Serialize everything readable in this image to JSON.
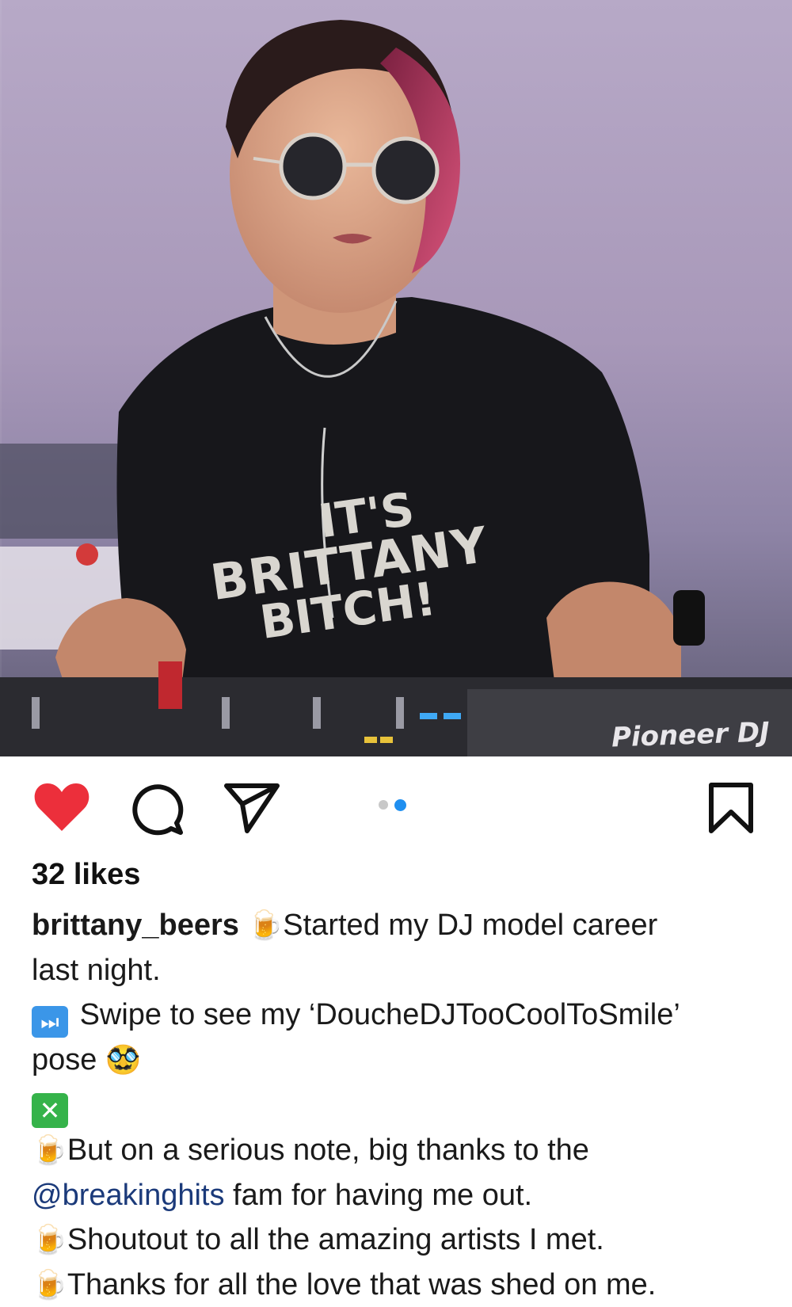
{
  "photo": {
    "alt_subject": "DJ at turntables",
    "shirt_lines": [
      "IT'S",
      "BRITTANY",
      "BITCH!"
    ],
    "brand_label": "Pioneer DJ"
  },
  "actions": {
    "like_icon": "heart-icon",
    "liked": true,
    "like_color": "#ec2f3b",
    "comment_icon": "comment-bubble-icon",
    "share_icon": "paper-plane-icon",
    "save_icon": "bookmark-icon",
    "carousel": {
      "count": 2,
      "active_index": 1,
      "active_color": "#1f8ff0"
    }
  },
  "post": {
    "likes_text": "32 likes",
    "username": "brittany_beers",
    "caption_lines": {
      "line1_text": "Started my DJ model career",
      "line2_text": "last night.",
      "line3_text": "Swipe to see my ‘DoucheDJTooCoolToSmile’",
      "line4_text": "pose",
      "line6_text": "But on a serious note, big thanks to the",
      "line7_mention": "@breakinghits",
      "line7_text": " fam for having me out.",
      "line8_text": "Shoutout to all the amazing artists I met.",
      "line9_text": "Thanks for all the love that was shed on me."
    },
    "emoji": {
      "beer": "🍺",
      "next_track": "⏭",
      "disguise": "🥸",
      "cross_mark": "✕"
    }
  }
}
